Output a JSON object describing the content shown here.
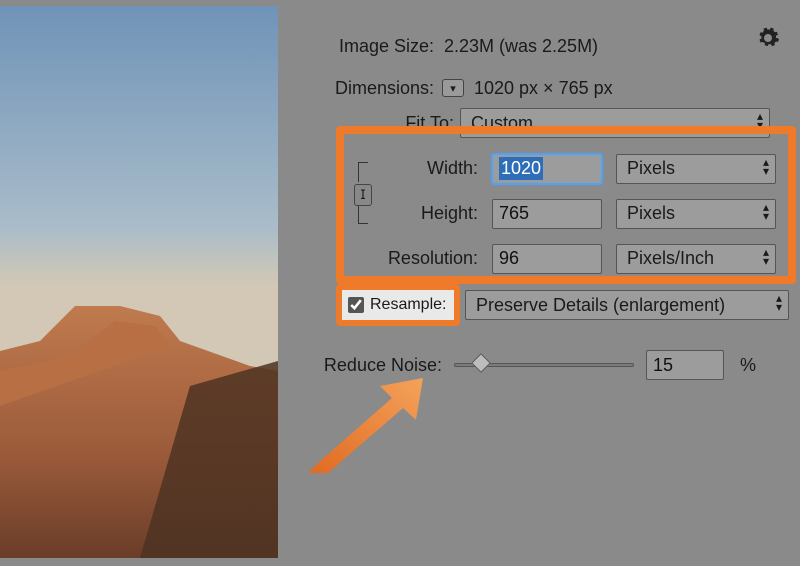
{
  "header": {
    "image_size_label": "Image Size:",
    "image_size_value": "2.23M (was 2.25M)",
    "dimensions_label": "Dimensions:",
    "dimensions_value": "1020 px  ×  765 px"
  },
  "fit_to": {
    "label": "Fit To:",
    "value": "Custom"
  },
  "width": {
    "label": "Width:",
    "value": "1020",
    "unit": "Pixels"
  },
  "height": {
    "label": "Height:",
    "value": "765",
    "unit": "Pixels"
  },
  "resolution": {
    "label": "Resolution:",
    "value": "96",
    "unit": "Pixels/Inch"
  },
  "resample": {
    "checkbox_label": "Resample:",
    "method": "Preserve Details (enlargement)"
  },
  "reduce_noise": {
    "label": "Reduce Noise:",
    "value": "15",
    "percent_symbol": "%",
    "slider_position_pct": 15
  },
  "colors": {
    "highlight": "#ef7a2a"
  },
  "icons": {
    "link": "link-icon",
    "gear": "gear-icon",
    "dim_toggle": "dimensions-toggle-icon"
  }
}
